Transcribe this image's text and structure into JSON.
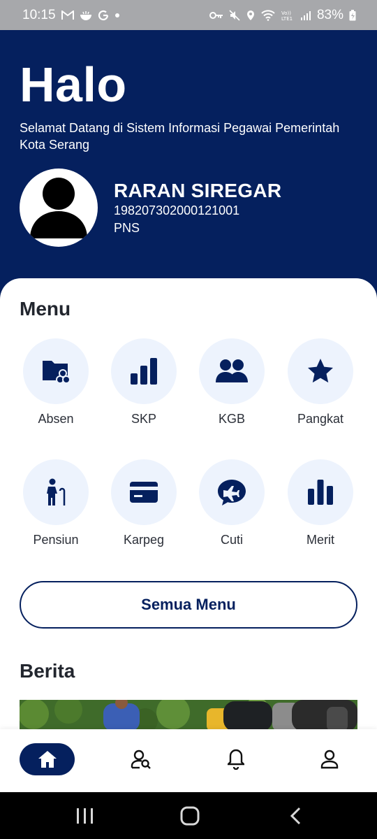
{
  "status_bar": {
    "time": "10:15",
    "battery": "83%",
    "left_icons": [
      "gmail-icon",
      "food-icon",
      "google-icon",
      "dot-icon"
    ],
    "right_icons": [
      "key-icon",
      "mute-icon",
      "location-icon",
      "wifi-icon",
      "volte-icon",
      "signal-icon",
      "battery-icon"
    ]
  },
  "header": {
    "greeting": "Halo",
    "welcome": "Selamat Datang di Sistem Informasi Pegawai Pemerintah Kota Serang",
    "profile": {
      "name": "RARAN SIREGAR",
      "nip": "198207302000121001",
      "role": "PNS"
    }
  },
  "menu": {
    "title": "Menu",
    "items": [
      {
        "label": "Absen",
        "icon": "folder-people-icon"
      },
      {
        "label": "SKP",
        "icon": "bar-chart-icon"
      },
      {
        "label": "KGB",
        "icon": "people-icon"
      },
      {
        "label": "Pangkat",
        "icon": "star-icon"
      },
      {
        "label": "Pensiun",
        "icon": "elderly-icon"
      },
      {
        "label": "Karpeg",
        "icon": "card-icon"
      },
      {
        "label": "Cuti",
        "icon": "plane-chat-icon"
      },
      {
        "label": "Merit",
        "icon": "column-chart-icon"
      }
    ],
    "all_button": "Semua Menu"
  },
  "news": {
    "title": "Berita"
  },
  "bottom_nav": {
    "items": [
      {
        "name": "home",
        "icon": "home-icon",
        "active": true
      },
      {
        "name": "search-user",
        "icon": "user-search-icon",
        "active": false
      },
      {
        "name": "notifications",
        "icon": "bell-icon",
        "active": false
      },
      {
        "name": "profile",
        "icon": "person-icon",
        "active": false
      }
    ]
  },
  "colors": {
    "primary": "#05205e",
    "icon_bg": "#edf3fd",
    "status_bar": "#a7a8ab",
    "text": "#1f2430"
  }
}
